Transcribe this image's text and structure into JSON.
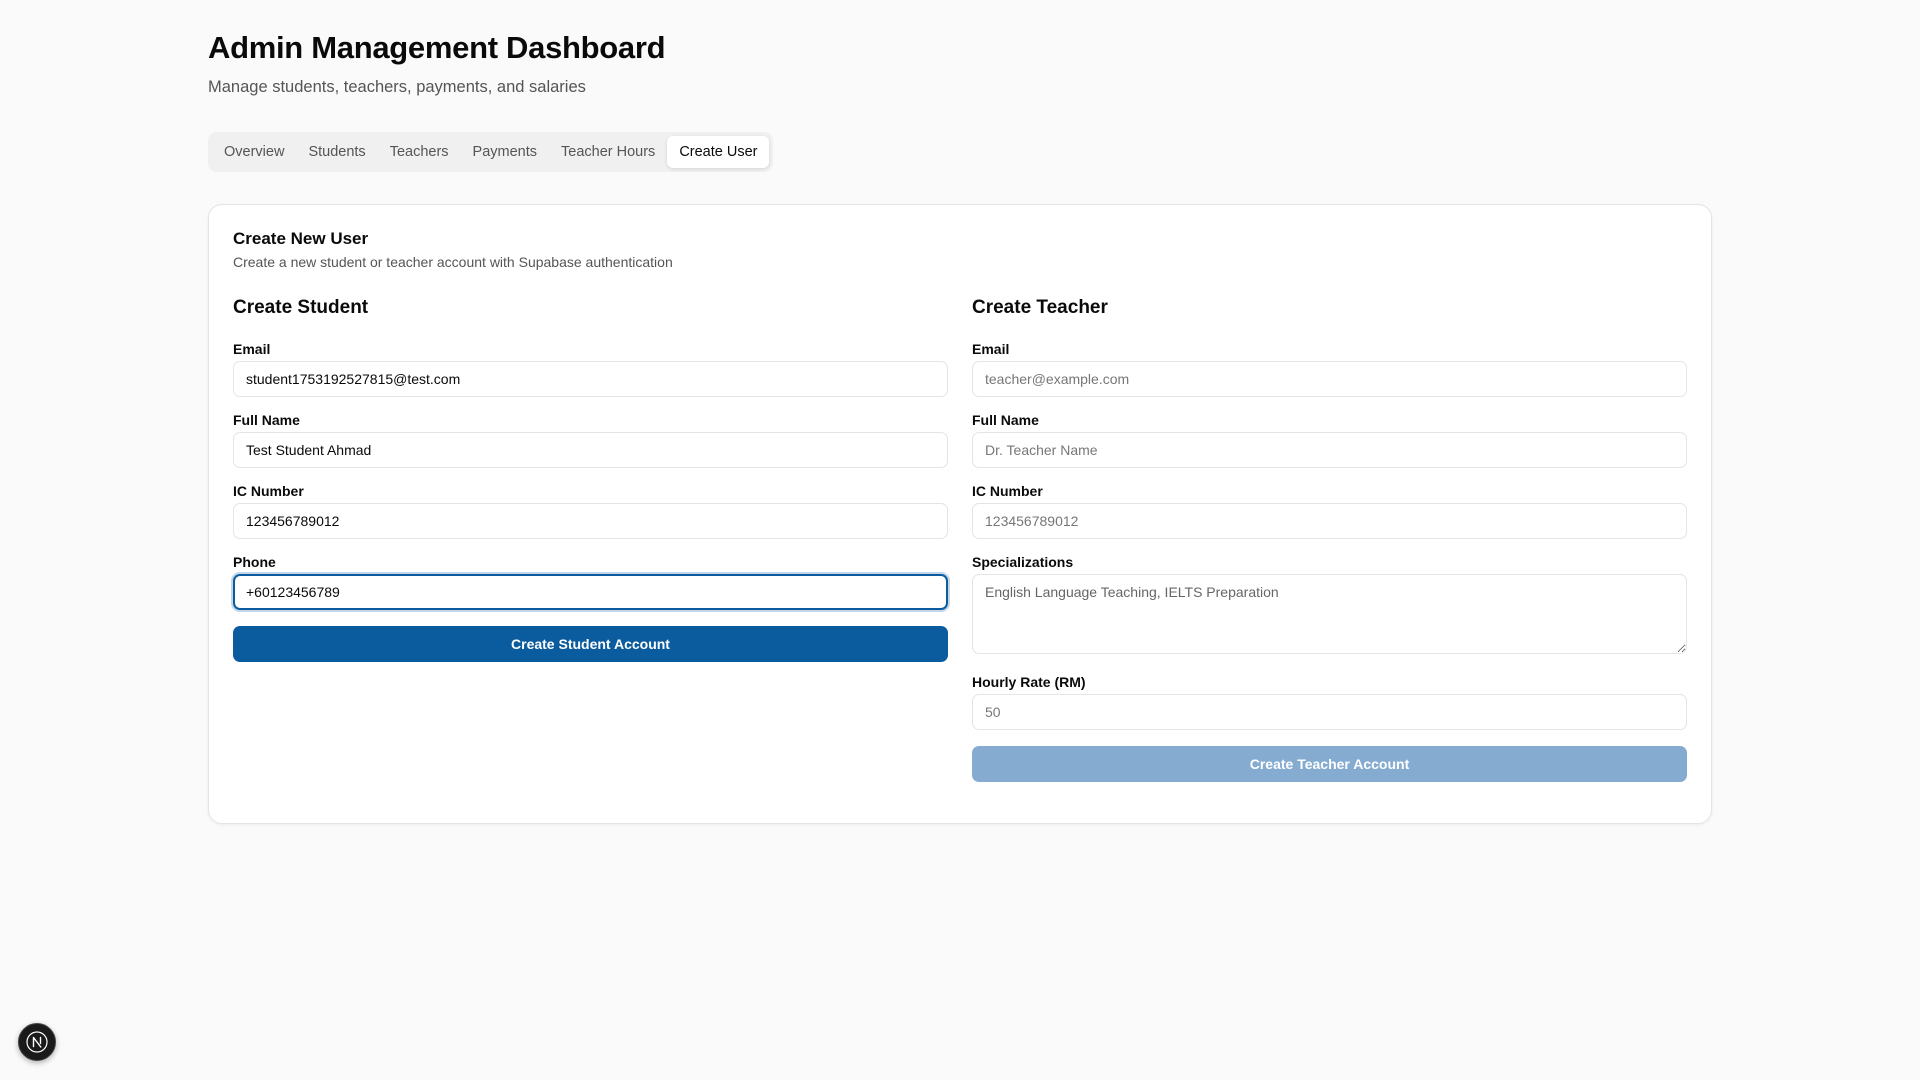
{
  "header": {
    "title": "Admin Management Dashboard",
    "subtitle": "Manage students, teachers, payments, and salaries"
  },
  "tabs": [
    {
      "label": "Overview",
      "active": false
    },
    {
      "label": "Students",
      "active": false
    },
    {
      "label": "Teachers",
      "active": false
    },
    {
      "label": "Payments",
      "active": false
    },
    {
      "label": "Teacher Hours",
      "active": false
    },
    {
      "label": "Create User",
      "active": true
    }
  ],
  "card": {
    "title": "Create New User",
    "description": "Create a new student or teacher account with Supabase authentication"
  },
  "student": {
    "title": "Create Student",
    "email_label": "Email",
    "email_value": "student1753192527815@test.com",
    "full_name_label": "Full Name",
    "full_name_value": "Test Student Ahmad",
    "ic_label": "IC Number",
    "ic_value": "123456789012",
    "phone_label": "Phone",
    "phone_value": "+60123456789",
    "submit_label": "Create Student Account"
  },
  "teacher": {
    "title": "Create Teacher",
    "email_label": "Email",
    "email_placeholder": "teacher@example.com",
    "full_name_label": "Full Name",
    "full_name_placeholder": "Dr. Teacher Name",
    "ic_label": "IC Number",
    "ic_placeholder": "123456789012",
    "specializations_label": "Specializations",
    "specializations_placeholder": "English Language Teaching, IELTS Preparation",
    "hourly_rate_label": "Hourly Rate (RM)",
    "hourly_rate_placeholder": "50",
    "submit_label": "Create Teacher Account"
  },
  "colors": {
    "primary": "#0b5c9e",
    "primary_disabled": "#85acd0",
    "background": "#fafafa"
  },
  "badge": {
    "icon": "nextjs-logo-icon",
    "letter": "N"
  }
}
